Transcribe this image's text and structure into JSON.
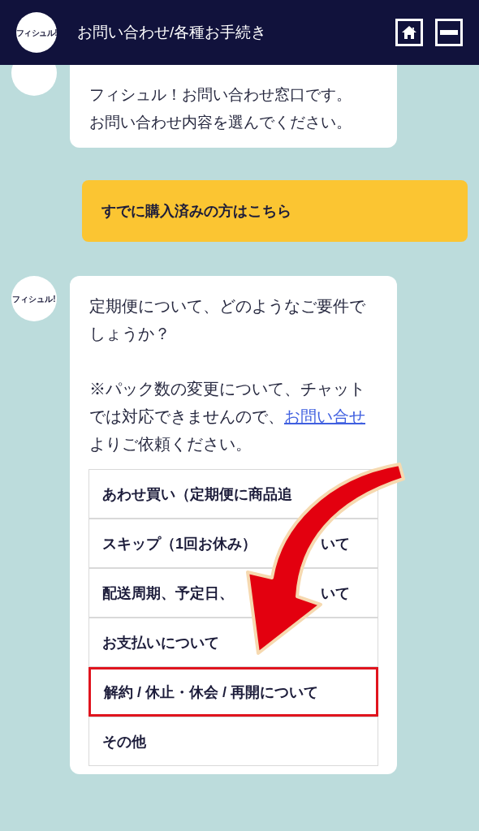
{
  "header": {
    "logo": "フィシュル!",
    "title": "お問い合わせ/各種お手続き"
  },
  "messages": [
    {
      "kind": "bot",
      "lines": [
        "フィシュル！お問い合わせ窓口です。",
        "お問い合わせ内容を選んでください。"
      ]
    },
    {
      "kind": "user",
      "text": "すでに購入済みの方はこちら"
    },
    {
      "kind": "bot",
      "avatar": "フィシュル!",
      "question": "定期便について、どのようなご要件でしょうか？",
      "note": {
        "before": "※パック数の変更について、チャットでは対応できませんので、",
        "link": "お問い合せ",
        "after": "よりご依頼ください。"
      },
      "options": [
        {
          "label": "あわせ買い（定期便に商品追",
          "highlighted": false
        },
        {
          "label": "スキップ（1回お休み）",
          "tail": "いて",
          "highlighted": false
        },
        {
          "label": "配送周期、予定日、",
          "tail": "いて",
          "highlighted": false
        },
        {
          "label": "お支払いについて",
          "highlighted": false
        },
        {
          "label": "解約 / 休止・休会 / 再開について",
          "highlighted": true
        },
        {
          "label": "その他",
          "highlighted": false
        }
      ]
    }
  ]
}
